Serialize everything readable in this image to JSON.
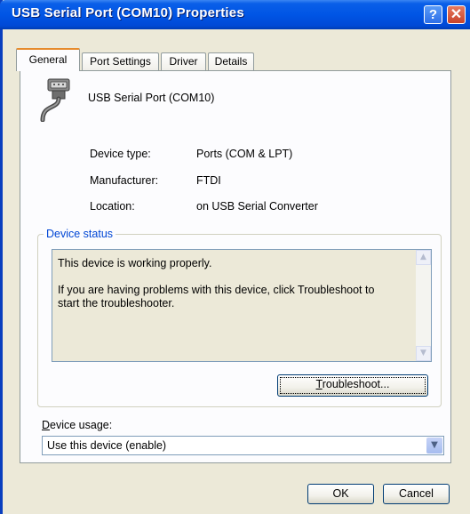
{
  "window": {
    "title": "USB Serial Port (COM10) Properties",
    "help_glyph": "?",
    "close_glyph": "✕",
    "accent": "#0055e5"
  },
  "tabs": [
    {
      "label": "General",
      "active": true
    },
    {
      "label": "Port Settings",
      "active": false
    },
    {
      "label": "Driver",
      "active": false
    },
    {
      "label": "Details",
      "active": false
    }
  ],
  "device": {
    "name": "USB Serial Port (COM10)",
    "icon": "serial-port-icon",
    "properties": [
      {
        "label": "Device type:",
        "value": "Ports (COM & LPT)"
      },
      {
        "label": "Manufacturer:",
        "value": "FTDI"
      },
      {
        "label": "Location:",
        "value": "on USB Serial Converter"
      }
    ]
  },
  "status": {
    "group_title": "Device status",
    "line1": "This device is working properly.",
    "line2": "If you are having problems with this device, click Troubleshoot to",
    "line3": "start the troubleshooter."
  },
  "troubleshoot_button": {
    "mnemonic": "T",
    "rest": "roubleshoot..."
  },
  "usage": {
    "label_mnemonic": "D",
    "label_rest": "evice usage:",
    "selected": "Use this device (enable)"
  },
  "footer": {
    "ok_label": "OK",
    "cancel_label": "Cancel"
  }
}
